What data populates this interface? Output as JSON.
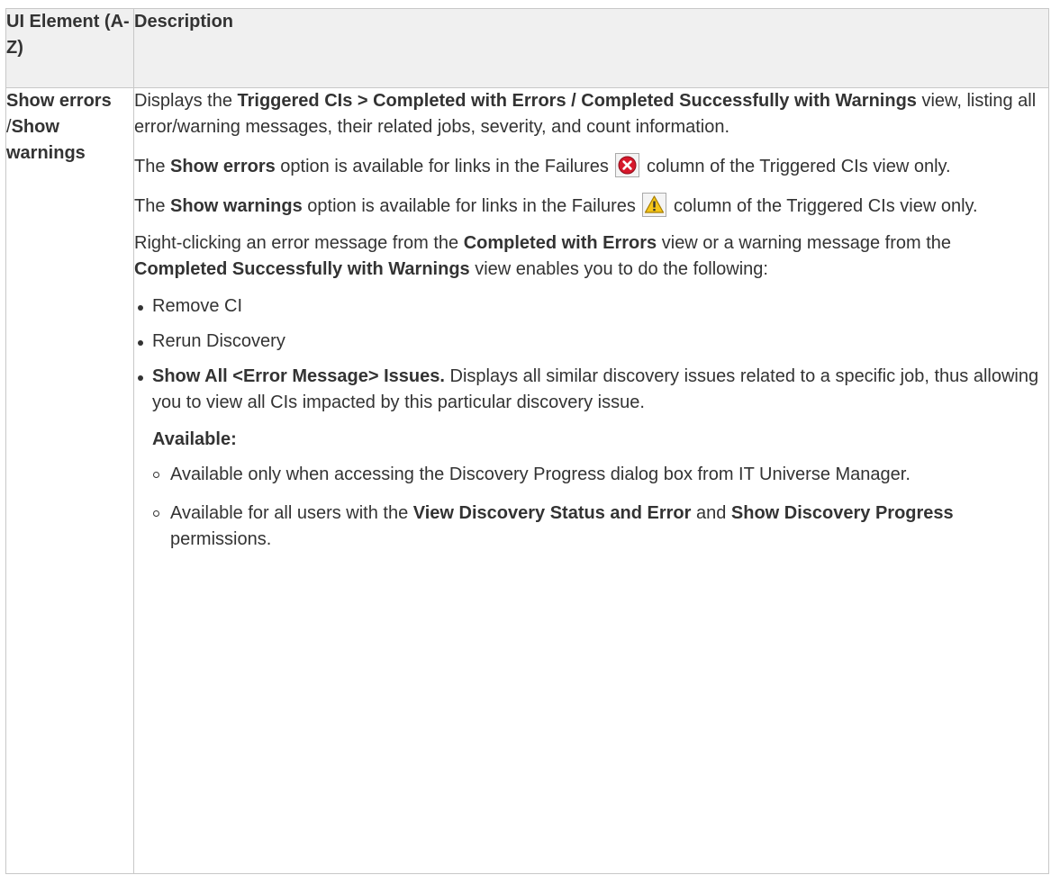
{
  "table": {
    "header": {
      "col1": "UI Element (A-Z)",
      "col2": "Description"
    },
    "row": {
      "element": {
        "part1": "Show errors",
        "separator": "/",
        "part2": "Show warnings"
      },
      "para1": {
        "t1": "Displays the ",
        "b1": "Triggered CIs > Completed with Errors / Completed Successfully with Warnings",
        "t2": " view, listing all error/warning messages, their related jobs, severity, and count information."
      },
      "para2": {
        "t1": "The ",
        "b1": "Show errors",
        "t2": " option is available for links in the Failures ",
        "t3": " column of the Triggered CIs view only."
      },
      "para3": {
        "t1": "The ",
        "b1": "Show warnings",
        "t2": " option is available for links in the Failures ",
        "t3": " column of the Triggered CIs view only."
      },
      "para4": {
        "t1": "Right-clicking an error message from the ",
        "b1": "Completed with Errors",
        "t2": " view or a warning message from the ",
        "b2": "Completed Successfully with Warnings",
        "t3": " view enables you to do the following:"
      },
      "bullets": {
        "item1": "Remove CI",
        "item2": "Rerun Discovery",
        "item3_bold": "Show All <Error Message> Issues.",
        "item3_text": " Displays all similar discovery issues related to a specific job, thus allowing you to view all CIs impacted by this particular discovery issue."
      },
      "available": {
        "heading": "Available:",
        "sub1": "Available only when accessing the Discovery Progress dialog box from IT Universe Manager.",
        "sub2_t1": "Available for all users with the ",
        "sub2_b1": "View Discovery Status and Error",
        "sub2_t2": " and ",
        "sub2_b2": "Show Discovery Progress",
        "sub2_t3": " permissions."
      }
    }
  },
  "icons": {
    "error_icon": "error-circle-x-icon",
    "warning_icon": "warning-triangle-icon",
    "error_color": "#d6182b",
    "warning_color": "#f5c518"
  }
}
